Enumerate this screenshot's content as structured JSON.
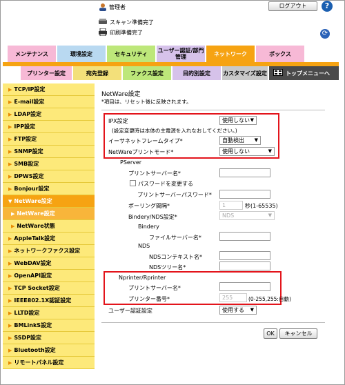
{
  "header": {
    "user_label": "管理者",
    "logout_label": "ログアウト",
    "help_label": "?",
    "scan_status": "スキャン準備完了",
    "print_status": "印刷準備完了"
  },
  "main_tabs": [
    "メンテナンス",
    "環境設定",
    "セキュリティ",
    "ユーザー認証/部門管理",
    "ネットワーク",
    "ボックス"
  ],
  "sub_tabs": [
    "プリンター設定",
    "宛先登録",
    "ファクス設定",
    "目的別設定",
    "カスタマイズ設定",
    "トップメニューへ"
  ],
  "sidebar": [
    "TCP/IP設定",
    "E-mail設定",
    "LDAP設定",
    "IPP設定",
    "FTP設定",
    "SNMP設定",
    "SMB設定",
    "DPWS設定",
    "Bonjour設定",
    "NetWare設定",
    "NetWare設定",
    "NetWare状態",
    "AppleTalk設定",
    "ネットワークファクス設定",
    "WebDAV設定",
    "OpenAPI設定",
    "TCP Socket設定",
    "IEEE802.1X認証設定",
    "LLTD設定",
    "BMLinkS設定",
    "SSDP設定",
    "Bluetooth設定",
    "リモートパネル設定"
  ],
  "page": {
    "title": "NetWare設定",
    "note": "*項目は、リセット後に反映されます。"
  },
  "form": {
    "ipx_label": "IPX設定",
    "ipx_value": "使用しない",
    "ipx_note": "(設定変更時は本体の主電源を入れなおしてください。)",
    "frame_label": "イーサネットフレームタイプ*",
    "frame_value": "自動検出",
    "print_mode_label": "NetWareプリントモード*",
    "print_mode_value": "使用しない",
    "pserver_label": "PServer",
    "print_server_name_label": "プリントサーバー名*",
    "change_password_label": "パスワードを変更する",
    "print_server_password_label": "プリントサーバーパスワード*",
    "polling_label": "ポーリング間隔*",
    "polling_value": "1",
    "polling_unit": "秒(1-65535)",
    "bindery_nds_label": "Bindery/NDS設定*",
    "bindery_nds_value": "NDS",
    "bindery_label": "Bindery",
    "file_server_label": "ファイルサーバー名*",
    "nds_label": "NDS",
    "nds_context_label": "NDSコンテキスト名*",
    "nds_tree_label": "NDSツリー名*",
    "nprinter_label": "Nprinter/Rprinter",
    "nprinter_server_label": "プリントサーバー名*",
    "printer_number_label": "プリンター番号*",
    "printer_number_value": "255",
    "printer_number_range": "(0-255,255:自動)",
    "user_auth_label": "ユーザー認証設定",
    "user_auth_value": "使用する",
    "ok_label": "OK",
    "cancel_label": "キャンセル"
  },
  "colors": {
    "accent_red": "#e3141b",
    "sidebar_yellow": "#fde97a",
    "sidebar_active": "#f6a312",
    "tab_network": "#f6a312"
  }
}
